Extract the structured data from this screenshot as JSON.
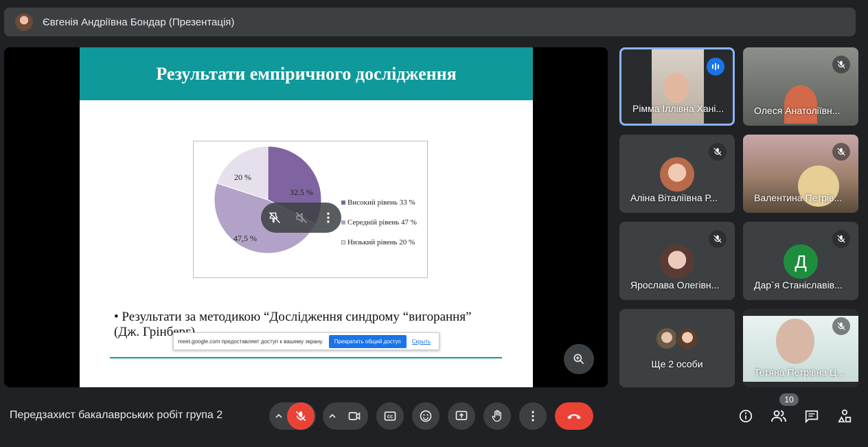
{
  "header": {
    "presenter_title": "Євгенія Андріївна Бондар (Презентація)"
  },
  "slide": {
    "title": "Результати емпіричного дослідження",
    "bullet": "Результати за методикою “Дослідження синдрому “вигорання” (Дж. Грінберг)"
  },
  "chart_data": {
    "type": "pie",
    "values": [
      32.5,
      47.5,
      20
    ],
    "value_labels": [
      "32.5 %",
      "47,5 %",
      "20 %"
    ],
    "legend": [
      "Високий рівень 33 %",
      "Середній рівень 47 %",
      "Низький рівень 20 %"
    ],
    "colors": [
      "#8064a2",
      "#b3a2c7",
      "#e6e0ec"
    ],
    "legend_position": "right"
  },
  "share_notice": {
    "text": "meet.google.com предоставляет доступ к вашему экрану.",
    "stop_button": "Прекратить общий доступ",
    "hide_link": "Скрыть"
  },
  "participants": [
    {
      "name": "Рімма Іллівна Хані...",
      "mic": "speaking"
    },
    {
      "name": "Олеся Анатоліївн...",
      "mic": "muted"
    },
    {
      "name": "Аліна Віталіївна Р...",
      "mic": "muted"
    },
    {
      "name": "Валентина Петрів...",
      "mic": "muted"
    },
    {
      "name": "Ярослава Олегівн...",
      "mic": "muted"
    },
    {
      "name": "Дар`я Станіславів...",
      "mic": "muted",
      "initial": "Д",
      "avatar_color": "#1e8e3e"
    },
    {
      "name": "Ще 2 особи"
    },
    {
      "name": "Тетяна Петрівна Ц...",
      "mic": "muted"
    }
  ],
  "bottom": {
    "meeting_name": "Передзахист бакалаврських робіт група 2",
    "participant_count": "10"
  },
  "colors": {
    "accent_teal": "#10999b",
    "end_call": "#ea4335",
    "active_border": "#8ab4f8"
  }
}
